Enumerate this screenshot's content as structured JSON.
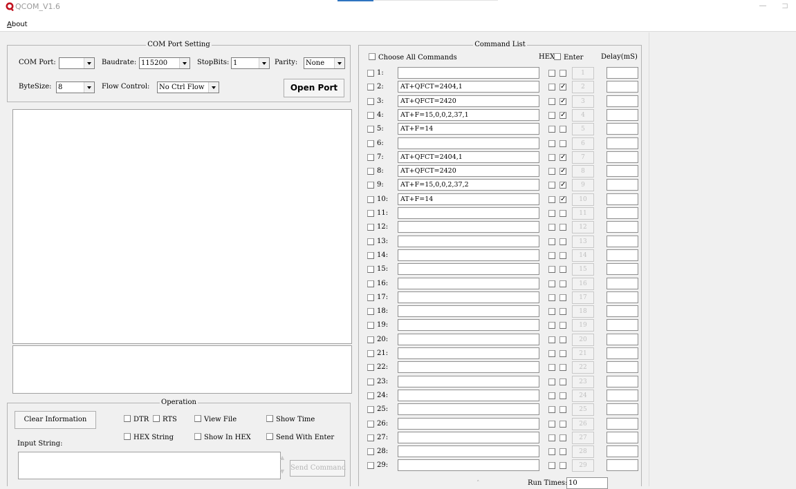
{
  "window": {
    "title": "QCOM_V1.6"
  },
  "menu": {
    "about": "About"
  },
  "com_port_setting": {
    "title": "COM Port Setting",
    "com_port_label": "COM Port:",
    "com_port_value": "",
    "baudrate_label": "Baudrate:",
    "baudrate_value": "115200",
    "stopbits_label": "StopBits:",
    "stopbits_value": "1",
    "parity_label": "Parity:",
    "parity_value": "None",
    "bytesize_label": "ByteSize:",
    "bytesize_value": "8",
    "flow_control_label": "Flow Control:",
    "flow_control_value": "No Ctrl Flow",
    "open_port_label": "Open Port"
  },
  "operation": {
    "title": "Operation",
    "clear_info_label": "Clear Information",
    "dtr_label": "DTR",
    "rts_label": "RTS",
    "view_file_label": "View File",
    "show_time_label": "Show Time",
    "hex_string_label": "HEX String",
    "show_in_hex_label": "Show In HEX",
    "send_with_enter_label": "Send With Enter",
    "input_string_label": "Input String:",
    "send_command_label": "Send Command"
  },
  "command_list": {
    "title": "Command List",
    "choose_all_label": "Choose All Commands",
    "hex_header": "HEX",
    "enter_header": "Enter",
    "delay_header": "Delay(mS)",
    "run_times_label": "Run Times:",
    "run_times_value": "10",
    "rows": [
      {
        "index": "1:",
        "command": "",
        "enter": false,
        "button": "1"
      },
      {
        "index": "2:",
        "command": "AT+QFCT=2404,1",
        "enter": true,
        "button": "2"
      },
      {
        "index": "3:",
        "command": "AT+QFCT=2420",
        "enter": true,
        "button": "3"
      },
      {
        "index": "4:",
        "command": "AT+F=15,0,0,2,37,1",
        "enter": true,
        "button": "4"
      },
      {
        "index": "5:",
        "command": "AT+F=14",
        "enter": false,
        "button": "5"
      },
      {
        "index": "6:",
        "command": "",
        "enter": false,
        "button": "6"
      },
      {
        "index": "7:",
        "command": "AT+QFCT=2404,1",
        "enter": true,
        "button": "7"
      },
      {
        "index": "8:",
        "command": "AT+QFCT=2420",
        "enter": true,
        "button": "8"
      },
      {
        "index": "9:",
        "command": "AT+F=15,0,0,2,37,2",
        "enter": true,
        "button": "9"
      },
      {
        "index": "10:",
        "command": "AT+F=14",
        "enter": true,
        "button": "10"
      },
      {
        "index": "11:",
        "command": "",
        "enter": false,
        "button": "11"
      },
      {
        "index": "12:",
        "command": "",
        "enter": false,
        "button": "12"
      },
      {
        "index": "13:",
        "command": "",
        "enter": false,
        "button": "13"
      },
      {
        "index": "14:",
        "command": "",
        "enter": false,
        "button": "14"
      },
      {
        "index": "15:",
        "command": "",
        "enter": false,
        "button": "15"
      },
      {
        "index": "16:",
        "command": "",
        "enter": false,
        "button": "16"
      },
      {
        "index": "17:",
        "command": "",
        "enter": false,
        "button": "17"
      },
      {
        "index": "18:",
        "command": "",
        "enter": false,
        "button": "18"
      },
      {
        "index": "19:",
        "command": "",
        "enter": false,
        "button": "19"
      },
      {
        "index": "20:",
        "command": "",
        "enter": false,
        "button": "20"
      },
      {
        "index": "21:",
        "command": "",
        "enter": false,
        "button": "21"
      },
      {
        "index": "22:",
        "command": "",
        "enter": false,
        "button": "22"
      },
      {
        "index": "23:",
        "command": "",
        "enter": false,
        "button": "23"
      },
      {
        "index": "24:",
        "command": "",
        "enter": false,
        "button": "24"
      },
      {
        "index": "25:",
        "command": "",
        "enter": false,
        "button": "25"
      },
      {
        "index": "26:",
        "command": "",
        "enter": false,
        "button": "26"
      },
      {
        "index": "27:",
        "command": "",
        "enter": false,
        "button": "27"
      },
      {
        "index": "28:",
        "command": "",
        "enter": false,
        "button": "28"
      },
      {
        "index": "29:",
        "command": "",
        "enter": false,
        "button": "29"
      }
    ]
  },
  "icons": {
    "app": "qcom-logo-icon",
    "check": "✓"
  },
  "colors": {
    "accent": "#2f74c0",
    "logo": "#c1121f"
  }
}
